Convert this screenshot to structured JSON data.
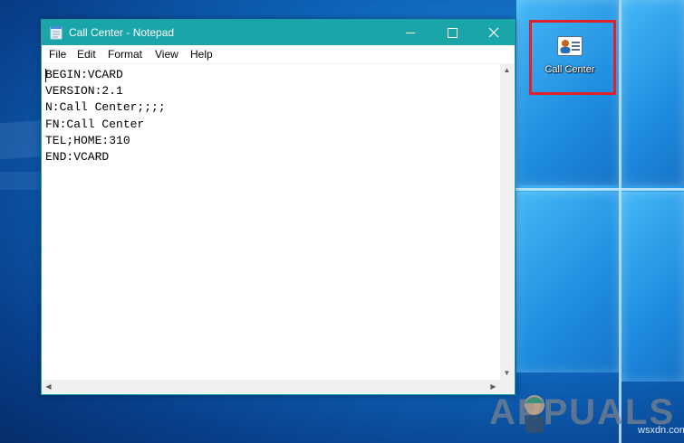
{
  "notepad": {
    "title": "Call Center - Notepad",
    "menu": [
      "File",
      "Edit",
      "Format",
      "View",
      "Help"
    ],
    "content_lines": [
      "BEGIN:VCARD",
      "VERSION:2.1",
      "N:Call Center;;;;",
      "FN:Call Center",
      "TEL;HOME:310",
      "END:VCARD"
    ]
  },
  "desktop": {
    "icon_label": "Call Center",
    "highlight_color": "#e0202a"
  },
  "watermarks": {
    "brand": "APPUALS",
    "site": "wsxdn.com"
  },
  "colors": {
    "titlebar": "#1aa5a8",
    "desktop_accent": "#1a86dc"
  }
}
